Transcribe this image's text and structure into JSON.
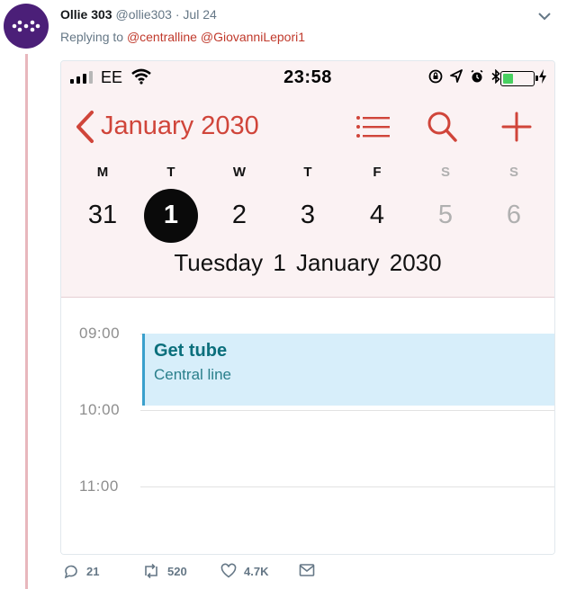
{
  "tweet": {
    "author_name": "Ollie 303",
    "author_handle": "@ollie303",
    "date": "· Jul 24",
    "replying_prefix": "Replying to",
    "reply_handles": [
      "@centralline",
      "@GiovanniLepori1"
    ]
  },
  "phone": {
    "carrier": "EE",
    "time": "23:58",
    "battery_level": 0.35,
    "month_title": "January 2030",
    "weekdays": [
      {
        "label": "M",
        "weekend": false
      },
      {
        "label": "T",
        "weekend": false
      },
      {
        "label": "W",
        "weekend": false
      },
      {
        "label": "T",
        "weekend": false
      },
      {
        "label": "F",
        "weekend": false
      },
      {
        "label": "S",
        "weekend": true
      },
      {
        "label": "S",
        "weekend": true
      }
    ],
    "dates": [
      {
        "label": "31",
        "selected": false,
        "weekend": false
      },
      {
        "label": "1",
        "selected": true,
        "weekend": false
      },
      {
        "label": "2",
        "selected": false,
        "weekend": false
      },
      {
        "label": "3",
        "selected": false,
        "weekend": false
      },
      {
        "label": "4",
        "selected": false,
        "weekend": false
      },
      {
        "label": "5",
        "selected": false,
        "weekend": true
      },
      {
        "label": "6",
        "selected": false,
        "weekend": true
      }
    ],
    "full_date": "Tuesday  1 January 2030",
    "times": [
      "09:00",
      "10:00",
      "11:00"
    ],
    "event": {
      "title": "Get tube",
      "location": "Central line"
    }
  },
  "actions": {
    "replies": "21",
    "retweets": "520",
    "likes": "4.7K"
  },
  "colors": {
    "accent_red": "#d0453a",
    "event_bg": "#d7eefa",
    "event_bar": "#3aa0cc"
  }
}
